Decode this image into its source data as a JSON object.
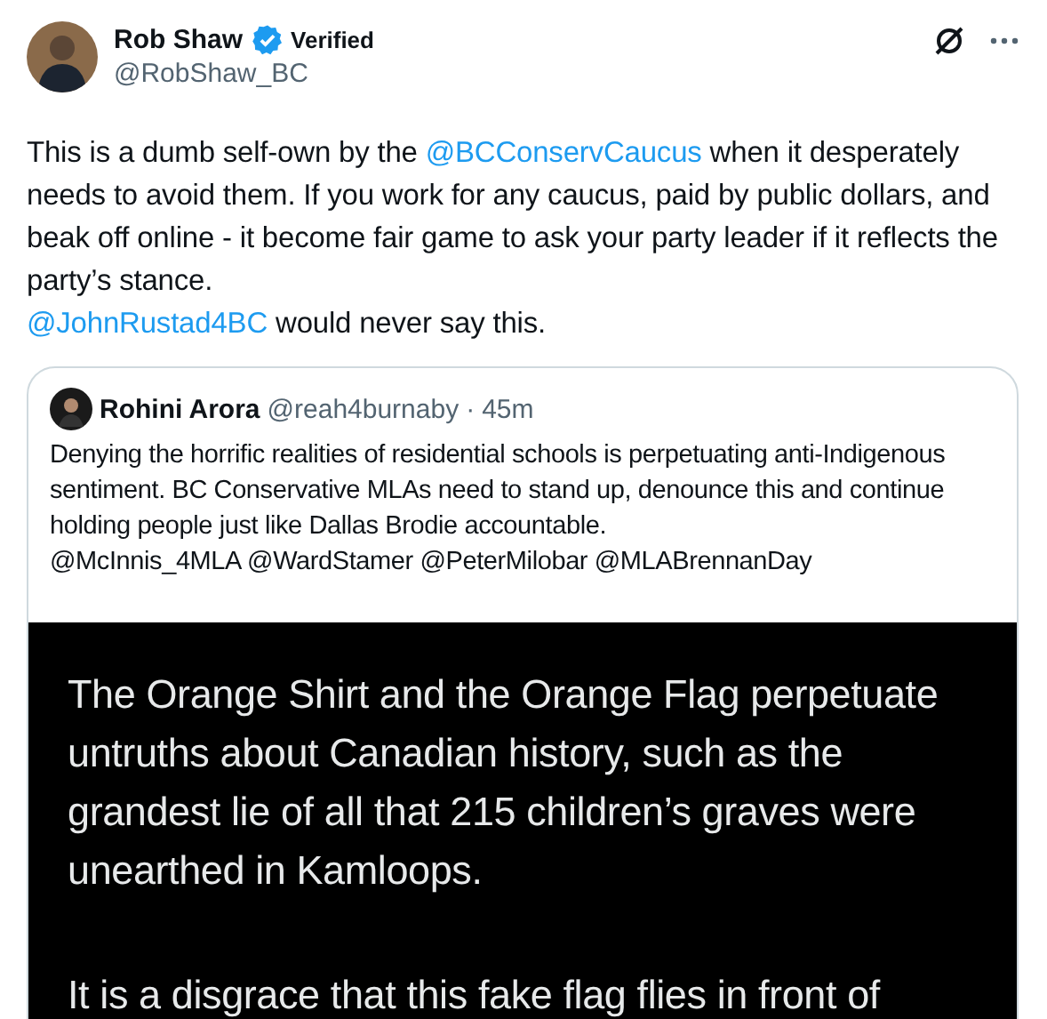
{
  "author": {
    "name": "Rob Shaw",
    "badge": "Verified",
    "handle": "@RobShaw_BC"
  },
  "body": [
    {
      "kind": "text",
      "text": "This is a dumb self-own by the "
    },
    {
      "kind": "mention",
      "text": "@BCConservCaucus"
    },
    {
      "kind": "text",
      "text": " when it desperately needs to avoid them. If you work for any caucus, paid by public dollars, and beak off online - it become fair game to ask your party leader if it reflects the party’s stance.\n"
    },
    {
      "kind": "mention",
      "text": "@JohnRustad4BC"
    },
    {
      "kind": "text",
      "text": " would never say this."
    }
  ],
  "quote": {
    "name": "Rohini Arora",
    "handle": "@reah4burnaby",
    "separator": "·",
    "time": "45m",
    "text": "Denying the horrific realities of residential schools is perpetuating anti-Indigenous sentiment. BC Conservative MLAs need to stand up, denounce this and continue holding people just like Dallas Brodie accountable.\n@McInnis_4MLA @WardStamer @PeterMilobar @MLABrennanDay",
    "image_paragraphs": [
      "The Orange Shirt and the Orange Flag perpetuate untruths about Canadian history, such as the grandest lie of all that 215 children’s graves were unearthed in Kamloops.",
      "It is a disgrace that this fake flag flies in front of"
    ]
  }
}
